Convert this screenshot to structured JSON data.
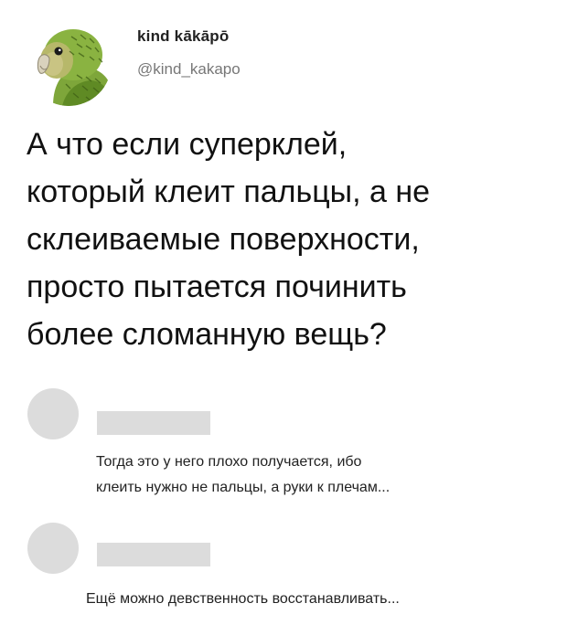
{
  "tweet": {
    "display_name": "kind kākāpō",
    "handle": "@kind_kakapo",
    "text_lines": [
      "А что если суперклей,",
      "который клеит пальцы, а не",
      "склеиваемые поверхности,",
      "просто пытается починить",
      "более сломанную вещь?"
    ]
  },
  "replies": [
    {
      "text_lines": [
        "Тогда это у него плохо получается, ибо",
        "клеить нужно не пальцы, а руки к плечам..."
      ]
    },
    {
      "text_lines": [
        "Ещё можно девственность восстанавливать..."
      ]
    }
  ],
  "colors": {
    "placeholder_gray": "#dcdcdc",
    "handle_gray": "#777777",
    "parrot_green": "#6f9a2e"
  },
  "icons": {
    "avatar": "kakapo-parrot-avatar"
  }
}
